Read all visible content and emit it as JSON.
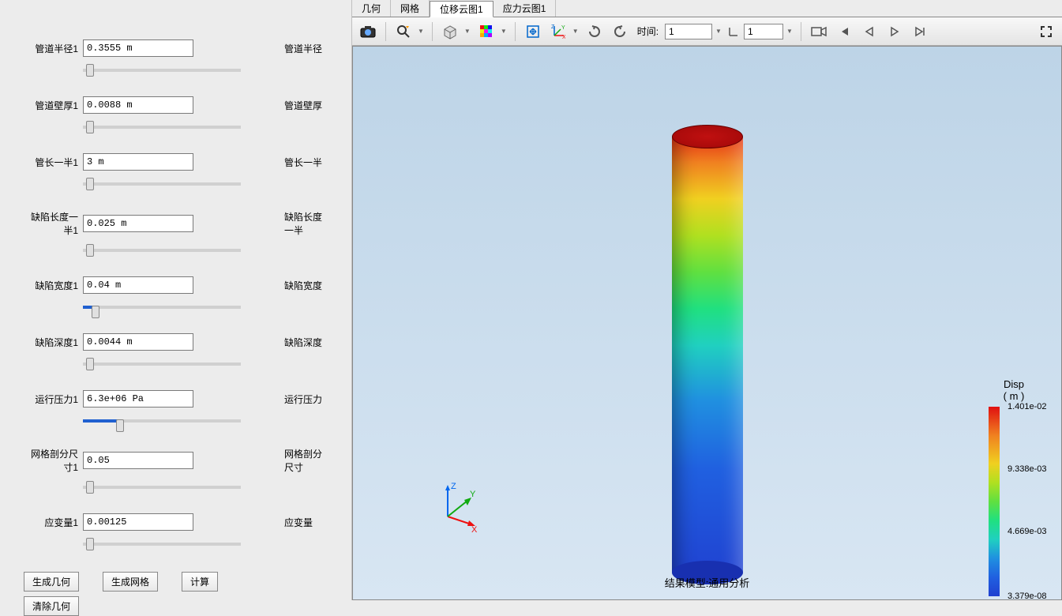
{
  "params": [
    {
      "label": "管道半径1",
      "value": "0.3555 m",
      "desc": "管道半径",
      "sliderPct": 2
    },
    {
      "label": "管道壁厚1",
      "value": "0.0088 m",
      "desc": "管道壁厚",
      "sliderPct": 2
    },
    {
      "label": "管长一半1",
      "value": "3 m",
      "desc": "管长一半",
      "sliderPct": 2
    },
    {
      "label": "缺陷长度一半1",
      "value": "0.025 m",
      "desc": "缺陷长度一半",
      "sliderPct": 2
    },
    {
      "label": "缺陷宽度1",
      "value": "0.04 m",
      "desc": "缺陷宽度",
      "sliderPct": 6,
      "blue": true
    },
    {
      "label": "缺陷深度1",
      "value": "0.0044 m",
      "desc": "缺陷深度",
      "sliderPct": 2
    },
    {
      "label": "运行压力1",
      "value": "6.3e+06 Pa",
      "desc": "运行压力",
      "sliderPct": 22,
      "blue": true
    },
    {
      "label": "网格剖分尺寸1",
      "value": "0.05",
      "desc": "网格剖分尺寸",
      "sliderPct": 2
    },
    {
      "label": "应变量1",
      "value": "0.00125",
      "desc": "应变量",
      "sliderPct": 2
    }
  ],
  "buttons": {
    "gen_geom": "生成几何",
    "gen_mesh": "生成网格",
    "calc": "计算",
    "clear_geom": "清除几何"
  },
  "tabs": [
    "几何",
    "网格",
    "位移云图1",
    "应力云图1"
  ],
  "activeTab": 2,
  "toolbar": {
    "time_label": "时间:",
    "time_val1": "1",
    "time_val2": "1"
  },
  "result_title": "结果模型:通用分析",
  "legend": {
    "title1": "Disp",
    "title2": "( m )",
    "ticks": [
      {
        "pos": 0,
        "val": "1.401e-02"
      },
      {
        "pos": 33,
        "val": "9.338e-03"
      },
      {
        "pos": 66,
        "val": "4.669e-03"
      },
      {
        "pos": 100,
        "val": "3.379e-08"
      }
    ]
  },
  "triad": {
    "x": "X",
    "y": "Y",
    "z": "Z"
  }
}
